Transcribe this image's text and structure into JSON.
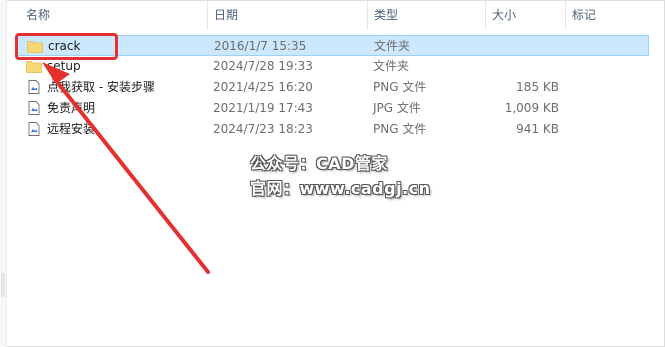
{
  "columns": {
    "name": "名称",
    "date": "日期",
    "type": "类型",
    "size": "大小",
    "tags": "标记"
  },
  "rows": [
    {
      "name": "crack",
      "date": "2016/1/7 15:35",
      "type": "文件夹",
      "size": "",
      "icon": "folder-icon",
      "selected": true
    },
    {
      "name": "setup",
      "date": "2024/7/28 19:33",
      "type": "文件夹",
      "size": "",
      "icon": "folder-icon"
    },
    {
      "name": "点我获取 - 安装步骤",
      "date": "2021/4/25 16:20",
      "type": "PNG 文件",
      "size": "185 KB",
      "icon": "image-file-icon"
    },
    {
      "name": "免责声明",
      "date": "2021/1/19 17:43",
      "type": "JPG 文件",
      "size": "1,009 KB",
      "icon": "image-file-icon"
    },
    {
      "name": "远程安装",
      "date": "2024/7/23 18:23",
      "type": "PNG 文件",
      "size": "941 KB",
      "icon": "image-file-icon"
    }
  ],
  "watermark": {
    "line1": "公众号：CAD管家",
    "line2": "官网：www.cadgj.cn"
  },
  "colors": {
    "selection_bg": "#cce8ff",
    "selection_border": "#99d1ff",
    "annotation_red": "#e53030",
    "folder_yellow": "#f8d775"
  }
}
